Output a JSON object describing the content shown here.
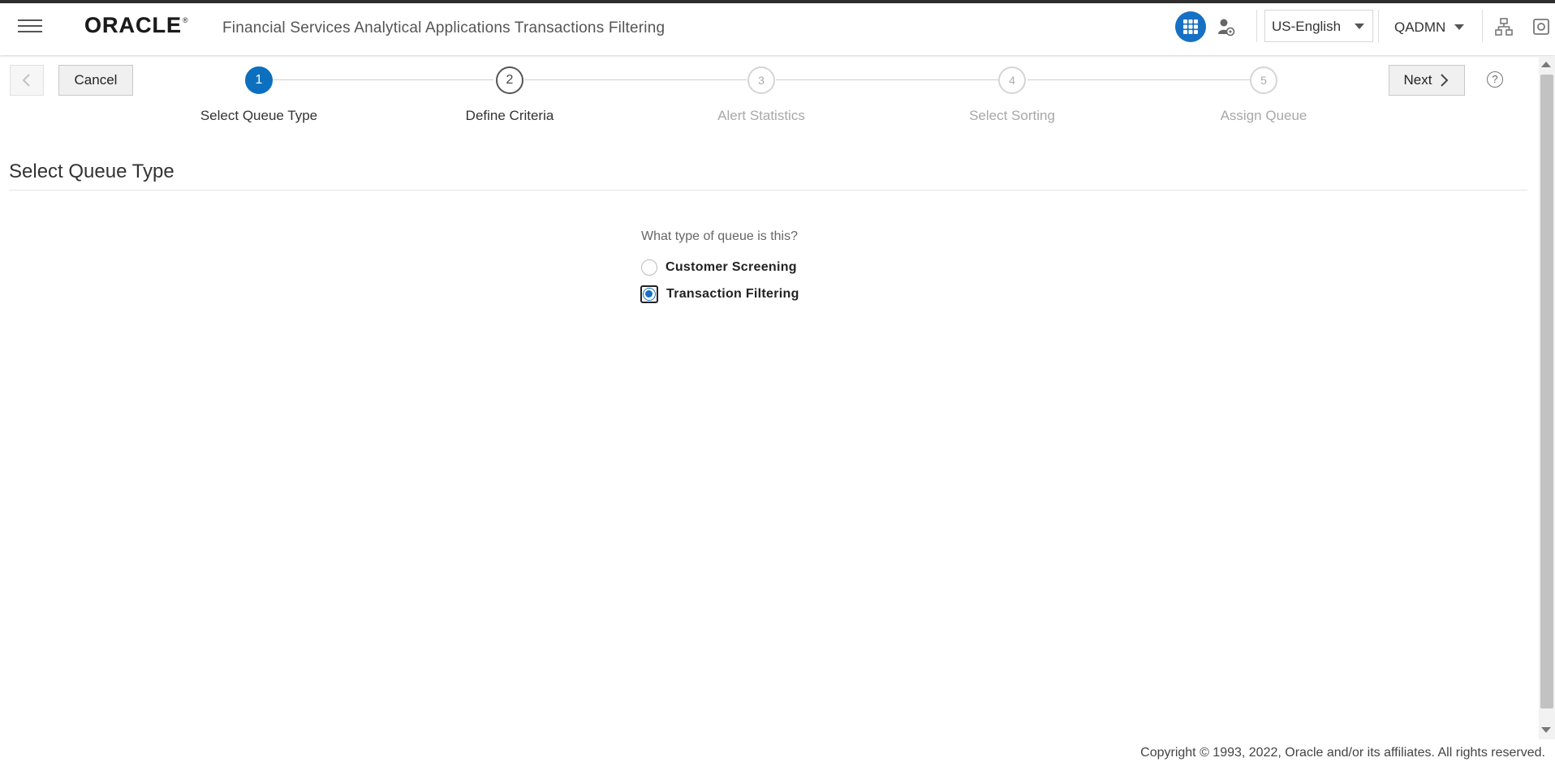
{
  "header": {
    "brand": "ORACLE",
    "brand_mark": "®",
    "app_title": "Financial Services Analytical Applications Transactions Filtering",
    "language": "US-English",
    "user": "QADMN",
    "icons": [
      "hamburger-menu-icon",
      "app-grid-icon",
      "user-admin-icon",
      "chevron-down-icon",
      "hierarchy-icon",
      "settings-icon"
    ],
    "accent_color": "#1670c4"
  },
  "wizard": {
    "cancel_label": "Cancel",
    "next_label": "Next",
    "help_label": "?",
    "steps": [
      {
        "number": "1",
        "label": "Select Queue Type",
        "state": "active"
      },
      {
        "number": "2",
        "label": "Define Criteria",
        "state": "visited"
      },
      {
        "number": "3",
        "label": "Alert Statistics",
        "state": "pending"
      },
      {
        "number": "4",
        "label": "Select Sorting",
        "state": "pending"
      },
      {
        "number": "5",
        "label": "Assign Queue",
        "state": "pending"
      }
    ]
  },
  "main": {
    "section_title": "Select Queue Type",
    "question": "What type of queue is this?",
    "options": [
      {
        "label": "Customer Screening",
        "checked": false
      },
      {
        "label": "Transaction Filtering",
        "checked": true
      }
    ]
  },
  "footer": {
    "copyright": "Copyright © 1993, 2022, Oracle and/or its affiliates. All rights reserved."
  }
}
